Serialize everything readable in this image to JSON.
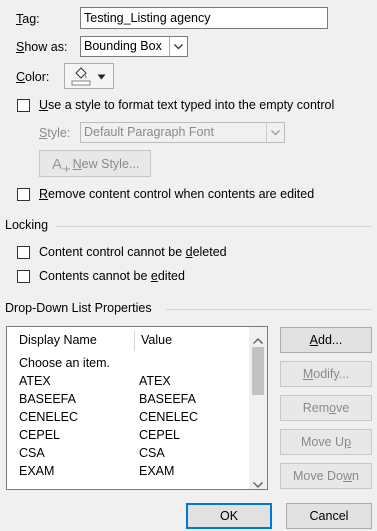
{
  "tag": {
    "label_pre": "",
    "label_u": "T",
    "label_post": "ag:",
    "value": "Testing_Listing agency"
  },
  "show_as": {
    "label_pre": "",
    "label_u": "S",
    "label_post": "how as:",
    "value": "Bounding Box"
  },
  "color": {
    "label_pre": "",
    "label_u": "C",
    "label_post": "olor:"
  },
  "use_style": {
    "label_pre": "",
    "label_u": "U",
    "label_post": "se a style to format text typed into the empty control"
  },
  "style": {
    "label_pre": "",
    "label_u": "S",
    "label_post": "tyle:",
    "value": "Default Paragraph Font"
  },
  "new_style": {
    "label_pre": "",
    "label_u": "N",
    "label_post": "ew Style..."
  },
  "remove_cc": {
    "label_pre": "",
    "label_u": "R",
    "label_post": "emove content control when contents are edited"
  },
  "locking": {
    "heading": "Locking"
  },
  "lock_delete": {
    "label_pre": "Content control cannot be ",
    "label_u": "d",
    "label_post": "eleted"
  },
  "lock_edit": {
    "label_pre": "Contents cannot be ",
    "label_u": "e",
    "label_post": "dited"
  },
  "dropdown": {
    "heading": "Drop-Down List Properties",
    "col_display": "Display Name",
    "col_value": "Value",
    "rows": [
      {
        "display": "Choose an item.",
        "value": ""
      },
      {
        "display": "ATEX",
        "value": "ATEX"
      },
      {
        "display": "BASEEFA",
        "value": "BASEEFA"
      },
      {
        "display": "CENELEC",
        "value": "CENELEC"
      },
      {
        "display": "CEPEL",
        "value": "CEPEL"
      },
      {
        "display": "CSA",
        "value": "CSA"
      },
      {
        "display": "EXAM",
        "value": "EXAM"
      }
    ]
  },
  "buttons": {
    "add": {
      "label_pre": "",
      "label_u": "A",
      "label_post": "dd..."
    },
    "modify": {
      "label_pre": "",
      "label_u": "M",
      "label_post": "odify..."
    },
    "remove": {
      "label_pre": "Rem",
      "label_u": "o",
      "label_post": "ve"
    },
    "move_up": {
      "label_pre": "Move U",
      "label_u": "p",
      "label_post": ""
    },
    "move_down": {
      "label_pre": "Move Do",
      "label_u": "w",
      "label_post": "n"
    },
    "ok": "OK",
    "cancel": "Cancel"
  },
  "colors": {
    "accent": "#0078d7",
    "paint_drop": "#2a6ebb"
  },
  "icons": {
    "color_picker": "paint-bucket-icon",
    "new_style": "new-style-icon",
    "dropdown": "chevron-down-icon"
  }
}
